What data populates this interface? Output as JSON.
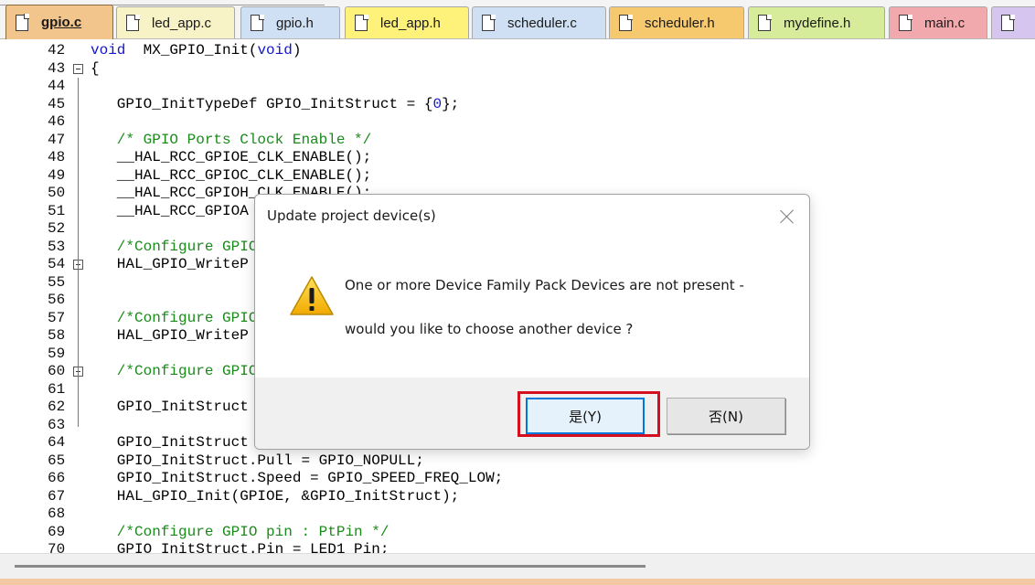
{
  "tabs": [
    {
      "label": "gpio.c",
      "color": "#f2c58d",
      "active": true
    },
    {
      "label": "led_app.c",
      "color": "#f8f3c7",
      "active": false
    },
    {
      "label": "gpio.h",
      "color": "#cfe0f5",
      "active": false
    },
    {
      "label": "led_app.h",
      "color": "#fff27a",
      "active": false
    },
    {
      "label": "scheduler.c",
      "color": "#cfe0f5",
      "active": false
    },
    {
      "label": "scheduler.h",
      "color": "#f6c96e",
      "active": false
    },
    {
      "label": "mydefine.h",
      "color": "#d7ec9a",
      "active": false
    },
    {
      "label": "main.c",
      "color": "#f2a9ad",
      "active": false
    },
    {
      "label": "",
      "color": "#d6c5ef",
      "active": false
    }
  ],
  "code_lines": [
    {
      "n": "42",
      "segs": [
        [
          "kw",
          "void"
        ],
        [
          "",
          "  MX_GPIO_Init("
        ],
        [
          "kw",
          "void"
        ],
        [
          "",
          ")"
        ]
      ]
    },
    {
      "n": "43",
      "segs": [
        [
          "",
          "{"
        ]
      ]
    },
    {
      "n": "44",
      "segs": []
    },
    {
      "n": "45",
      "segs": [
        [
          "",
          "   GPIO_InitTypeDef GPIO_InitStruct = {"
        ],
        [
          "num",
          "0"
        ],
        [
          "",
          "};"
        ]
      ]
    },
    {
      "n": "46",
      "segs": []
    },
    {
      "n": "47",
      "segs": [
        [
          "cm",
          "   /* GPIO Ports Clock Enable */"
        ]
      ]
    },
    {
      "n": "48",
      "segs": [
        [
          "",
          "   __HAL_RCC_GPIOE_CLK_ENABLE();"
        ]
      ]
    },
    {
      "n": "49",
      "segs": [
        [
          "",
          "   __HAL_RCC_GPIOC_CLK_ENABLE();"
        ]
      ]
    },
    {
      "n": "50",
      "segs": [
        [
          "",
          "   __HAL_RCC_GPIOH_CLK_ENABLE();"
        ]
      ]
    },
    {
      "n": "51",
      "segs": [
        [
          "",
          "   __HAL_RCC_GPIOA"
        ]
      ]
    },
    {
      "n": "52",
      "segs": []
    },
    {
      "n": "53",
      "segs": [
        [
          "cm",
          "   /*Configure GPIO"
        ]
      ]
    },
    {
      "n": "54",
      "segs": [
        [
          "",
          "   HAL_GPIO_WriteP"
        ]
      ]
    },
    {
      "n": "55",
      "segs": []
    },
    {
      "n": "56",
      "segs": []
    },
    {
      "n": "57",
      "segs": [
        [
          "cm",
          "   /*Configure GPIO"
        ]
      ]
    },
    {
      "n": "58",
      "segs": [
        [
          "",
          "   HAL_GPIO_WriteP"
        ]
      ]
    },
    {
      "n": "59",
      "segs": []
    },
    {
      "n": "60",
      "segs": [
        [
          "cm",
          "   /*Configure GPIO"
        ]
      ]
    },
    {
      "n": "61",
      "segs": []
    },
    {
      "n": "62",
      "segs": [
        [
          "",
          "   GPIO_InitStruct"
        ]
      ]
    },
    {
      "n": "63",
      "segs": []
    },
    {
      "n": "64",
      "segs": [
        [
          "",
          "   GPIO_InitStruct"
        ]
      ]
    },
    {
      "n": "65",
      "segs": [
        [
          "",
          "   GPIO_InitStruct.Pull = GPIO_NOPULL;"
        ]
      ]
    },
    {
      "n": "66",
      "segs": [
        [
          "",
          "   GPIO_InitStruct.Speed = GPIO_SPEED_FREQ_LOW;"
        ]
      ]
    },
    {
      "n": "67",
      "segs": [
        [
          "",
          "   HAL_GPIO_Init(GPIOE, &GPIO_InitStruct);"
        ]
      ]
    },
    {
      "n": "68",
      "segs": []
    },
    {
      "n": "69",
      "segs": [
        [
          "cm",
          "   /*Configure GPIO pin : PtPin */"
        ]
      ]
    },
    {
      "n": "70",
      "segs": [
        [
          "",
          "   GPIO_InitStruct.Pin = LED1_Pin;"
        ]
      ]
    }
  ],
  "dialog": {
    "title": "Update project device(s)",
    "message_line1": "One or more Device Family Pack Devices are not present -",
    "message_line2": "would you like to choose another device ?",
    "yes_label": "是(Y)",
    "no_label": "否(N)",
    "icon": "warning-icon",
    "highlight_color": "#d40f1f"
  }
}
